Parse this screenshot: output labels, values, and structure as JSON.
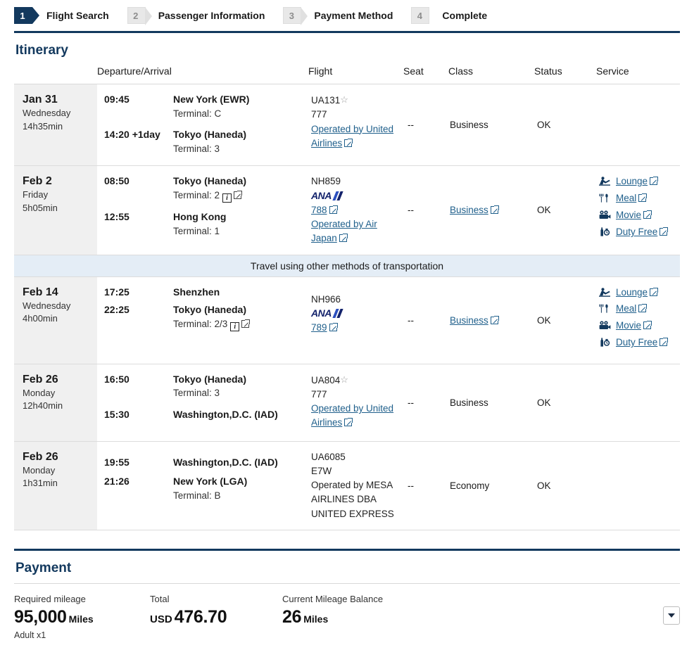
{
  "steps": [
    {
      "num": "1",
      "label": "Flight Search",
      "active": true
    },
    {
      "num": "2",
      "label": "Passenger Information",
      "active": false
    },
    {
      "num": "3",
      "label": "Payment Method",
      "active": false
    },
    {
      "num": "4",
      "label": "Complete",
      "active": false
    }
  ],
  "itinerary": {
    "title": "Itinerary",
    "columns": {
      "date": "",
      "departure_arrival": "Departure/Arrival",
      "flight": "Flight",
      "seat": "Seat",
      "class": "Class",
      "status": "Status",
      "service": "Service"
    },
    "transfer_banner": "Travel using other methods of transportation",
    "rows": [
      {
        "date": "Jan 31",
        "weekday": "Wednesday",
        "duration": "14h35min",
        "dep_time": "09:45",
        "dep_place": "New York (EWR)",
        "dep_terminal": "Terminal: C",
        "arr_time": "14:20 +1day",
        "arr_place": "Tokyo (Haneda)",
        "arr_terminal": "Terminal: 3",
        "flight_no": "UA131",
        "flight_star": "☆",
        "aircraft": "777",
        "operated_by": "Operated by United Airlines",
        "seat": "--",
        "class": "Business",
        "class_link": false,
        "status": "OK",
        "services": []
      },
      {
        "date": "Feb 2",
        "weekday": "Friday",
        "duration": "5h05min",
        "dep_time": "08:50",
        "dep_place": "Tokyo (Haneda)",
        "dep_terminal": "Terminal: 2",
        "dep_terminal_info": true,
        "arr_time": "12:55",
        "arr_place": "Hong Kong",
        "arr_terminal": "Terminal: 1",
        "flight_no": "NH859",
        "airline_logo": "ana-logo",
        "aircraft": "788",
        "aircraft_link": true,
        "operated_by": "Operated by Air Japan",
        "seat": "--",
        "class": "Business",
        "class_link": true,
        "status": "OK",
        "services": [
          {
            "icon": "lounge-icon",
            "label": "Lounge"
          },
          {
            "icon": "meal-icon",
            "label": "Meal"
          },
          {
            "icon": "movie-icon",
            "label": "Movie"
          },
          {
            "icon": "duty-free-icon",
            "label": "Duty Free"
          }
        ]
      },
      {
        "date": "Feb 14",
        "weekday": "Wednesday",
        "duration": "4h00min",
        "dep_time": "17:25",
        "dep_place": "Shenzhen",
        "dep_terminal": "",
        "arr_time": "22:25",
        "arr_place": "Tokyo (Haneda)",
        "arr_terminal": "Terminal: 2/3",
        "arr_terminal_info": true,
        "flight_no": "NH966",
        "airline_logo": "ana-logo",
        "aircraft": "789",
        "aircraft_link": true,
        "operated_by": "",
        "seat": "--",
        "class": "Business",
        "class_link": true,
        "status": "OK",
        "services": [
          {
            "icon": "lounge-icon",
            "label": "Lounge"
          },
          {
            "icon": "meal-icon",
            "label": "Meal"
          },
          {
            "icon": "movie-icon",
            "label": "Movie"
          },
          {
            "icon": "duty-free-icon",
            "label": "Duty Free"
          }
        ]
      },
      {
        "date": "Feb 26",
        "weekday": "Monday",
        "duration": "12h40min",
        "dep_time": "16:50",
        "dep_place": "Tokyo (Haneda)",
        "dep_terminal": "Terminal: 3",
        "arr_time": "15:30",
        "arr_place": "Washington,D.C. (IAD)",
        "arr_terminal": "",
        "flight_no": "UA804",
        "flight_star": "☆",
        "aircraft": "777",
        "operated_by": "Operated by United Airlines",
        "seat": "--",
        "class": "Business",
        "class_link": false,
        "status": "OK",
        "services": []
      },
      {
        "date": "Feb 26",
        "weekday": "Monday",
        "duration": "1h31min",
        "dep_time": "19:55",
        "dep_place": "Washington,D.C. (IAD)",
        "dep_terminal": "",
        "arr_time": "21:26",
        "arr_place": "New York (LGA)",
        "arr_terminal": "Terminal: B",
        "flight_no": "UA6085",
        "aircraft": "E7W",
        "operated_by_plain": "Operated by MESA AIRLINES DBA UNITED EXPRESS",
        "seat": "--",
        "class": "Economy",
        "class_link": false,
        "status": "OK",
        "services": []
      }
    ]
  },
  "payment": {
    "title": "Payment",
    "required_mileage_label": "Required mileage",
    "required_mileage_value": "95,000",
    "required_mileage_unit": "Miles",
    "required_mileage_note": "Adult x1",
    "total_label": "Total",
    "total_currency": "USD",
    "total_value": "476.70",
    "balance_label": "Current Mileage Balance",
    "balance_value": "26",
    "balance_unit": "Miles"
  },
  "colors": {
    "brand_navy": "#13395e",
    "link": "#1f5f8b",
    "banner_blue": "#e4edf6",
    "date_bg": "#f0f0f0",
    "ana_navy": "#13226b",
    "ana_blue": "#2b4fbf"
  }
}
